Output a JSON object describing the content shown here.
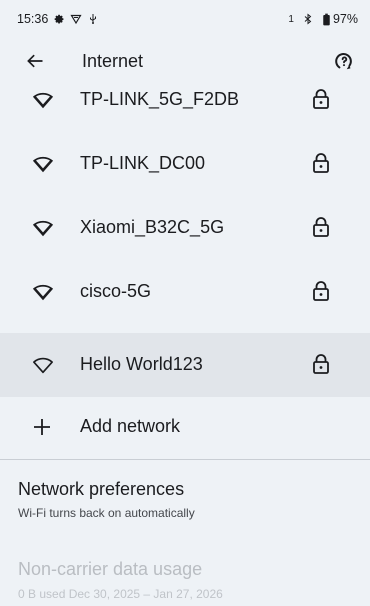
{
  "status_bar": {
    "time": "15:36",
    "sim_indicator": "1",
    "battery": "97%",
    "icons": [
      "gear-icon",
      "shield-icon",
      "usb-icon",
      "bluetooth-icon",
      "battery-icon"
    ]
  },
  "app_bar": {
    "title": "Internet",
    "back_icon": "arrow-left-icon",
    "help_icon": "help-icon"
  },
  "networks": [
    {
      "name": "TP-LINK_5G_F2DB",
      "icon": "wifi-icon",
      "secured": true
    },
    {
      "name": "TP-LINK_DC00",
      "icon": "wifi-icon",
      "secured": true
    },
    {
      "name": "Xiaomi_B32C_5G",
      "icon": "wifi-icon",
      "secured": true
    },
    {
      "name": "cisco-5G",
      "icon": "wifi-icon",
      "secured": true
    },
    {
      "name": "Hello World123",
      "icon": "wifi-outline-icon",
      "secured": true
    }
  ],
  "add_network": {
    "label": "Add network",
    "icon": "plus-icon"
  },
  "network_preferences": {
    "title": "Network preferences",
    "subtitle": "Wi-Fi turns back on automatically"
  },
  "data_usage": {
    "title": "Non-carrier data usage",
    "subtitle": "0 B used Dec 30, 2025 – Jan 27, 2026"
  },
  "colors": {
    "background": "#eef2f6",
    "highlight": "#e1e5ea",
    "text": "#1b1c1f",
    "disabled_text": "#b9bdc2"
  }
}
